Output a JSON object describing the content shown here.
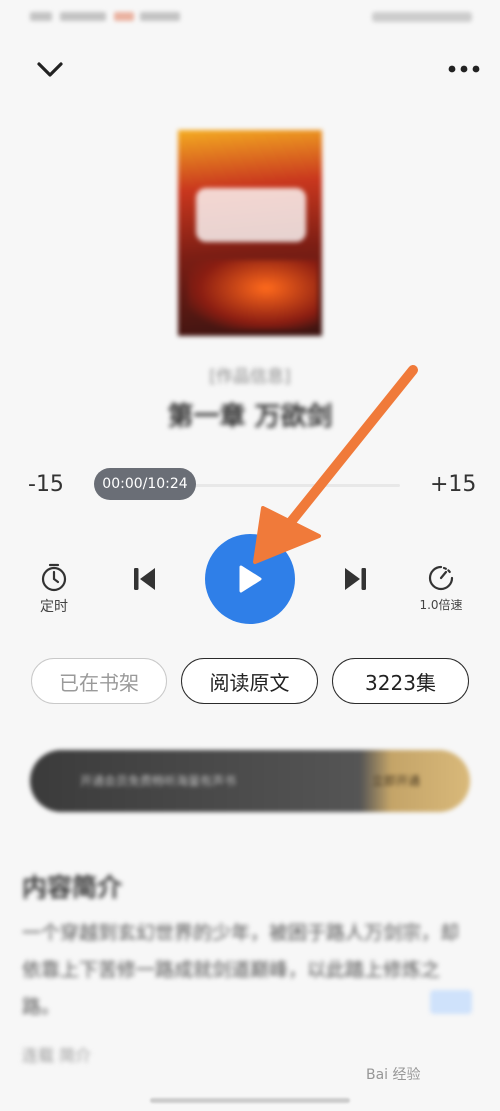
{
  "player": {
    "author": "[作品信息]",
    "chapter_title": "第一章 万欲剑",
    "skip_back_label": "-15",
    "skip_forward_label": "+15",
    "time_display": "00:00/10:24",
    "progress": 0.0,
    "timer_label": "定时",
    "speed_label": "1.0倍速"
  },
  "actions": {
    "shelf_label": "已在书架",
    "read_original_label": "阅读原文",
    "episodes_label": "3223集"
  },
  "banner": {
    "text": "开通会员免费畅听海量有声书",
    "cta": "立即开通"
  },
  "intro": {
    "title": "内容简介",
    "body": "一个穿越到玄幻世界的少年，被困于路人万剑宗，却依靠上下苦修一路成就剑道巅峰，以此踏上修炼之路。",
    "meta": "连载 简介"
  },
  "watermark": "Bai 经验",
  "colors": {
    "accent": "#2f7fe8",
    "arrow": "#f07a3a",
    "time_pill": "#6a6e76"
  },
  "icons": {
    "collapse": "chevron-down-icon",
    "more": "more-icon",
    "timer": "timer-icon",
    "previous": "skip-previous-icon",
    "play": "play-icon",
    "next": "skip-next-icon",
    "speed": "speed-icon"
  }
}
